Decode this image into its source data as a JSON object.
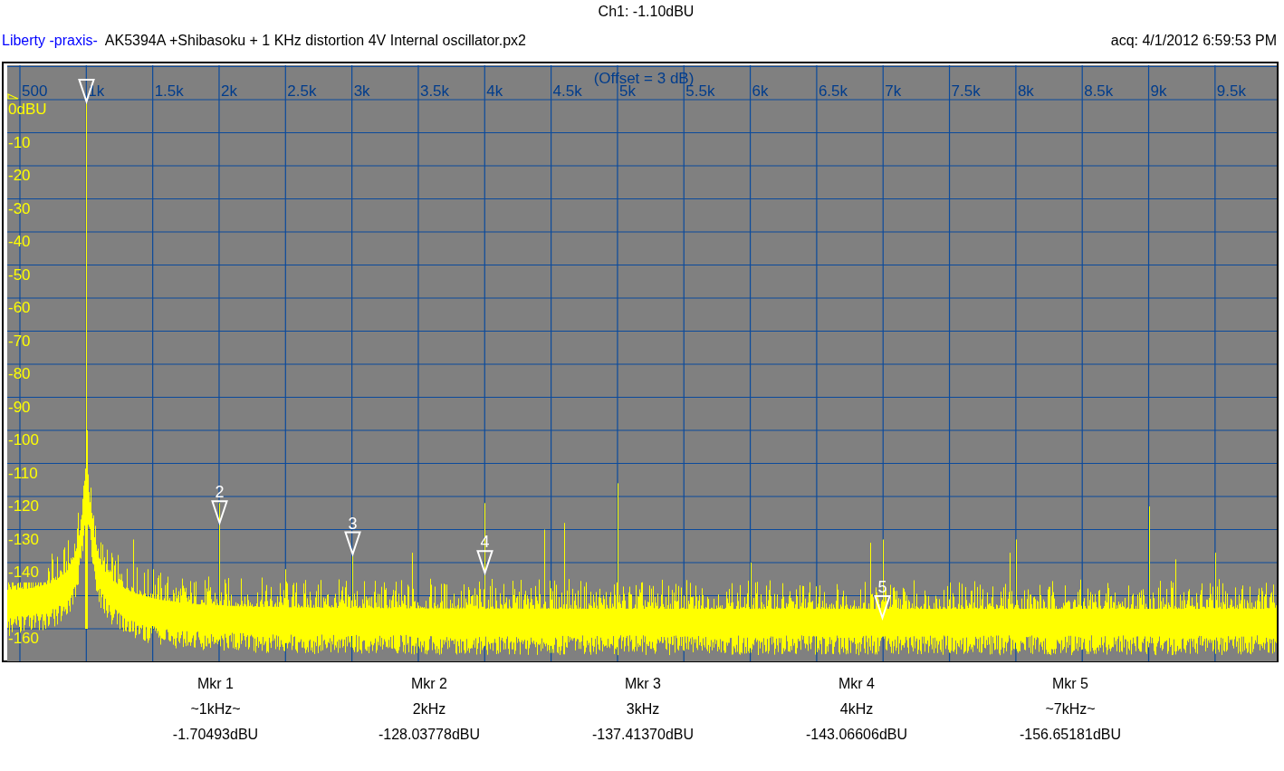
{
  "channel_reading": "Ch1: -1.10dBU",
  "header": {
    "source": "Liberty -praxis-",
    "title": "AK5394A +Shibasoku + 1 KHz distortion 4V Internal oscillator.px2",
    "acquired": "acq: 4/1/2012 6:59:53 PM"
  },
  "plot": {
    "offset_note": "(Offset = 3 dB)",
    "x_labels": [
      "500",
      "1k",
      "1.5k",
      "2k",
      "2.5k",
      "3k",
      "3.5k",
      "4k",
      "4.5k",
      "5k",
      "5.5k",
      "6k",
      "6.5k",
      "7k",
      "7.5k",
      "8k",
      "8.5k",
      "9k",
      "9.5k"
    ],
    "y_labels": [
      "0dBU",
      "-10",
      "-20",
      "-30",
      "-40",
      "-50",
      "-60",
      "-70",
      "-80",
      "-90",
      "-100",
      "-110",
      "-120",
      "-130",
      "-140",
      "-160"
    ],
    "marker_numbers": [
      "2",
      "3",
      "4",
      "5"
    ]
  },
  "markers": [
    {
      "label": "Mkr 1",
      "frequency": "~1kHz~",
      "value": "-1.70493dBU"
    },
    {
      "label": "Mkr 2",
      "frequency": "2kHz",
      "value": "-128.03778dBU"
    },
    {
      "label": "Mkr 3",
      "frequency": "3kHz",
      "value": "-137.41370dBU"
    },
    {
      "label": "Mkr 4",
      "frequency": "4kHz",
      "value": "-143.06606dBU"
    },
    {
      "label": "Mkr 5",
      "frequency": "~7kHz~",
      "value": "-156.65181dBU"
    }
  ]
}
